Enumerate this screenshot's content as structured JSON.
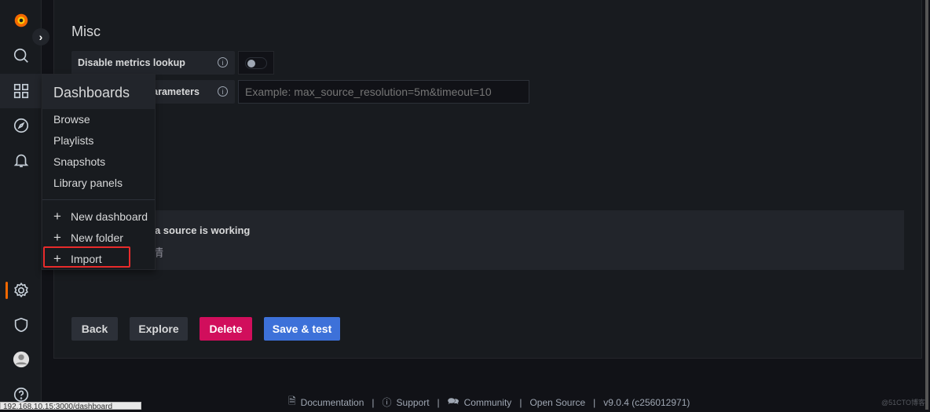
{
  "sidebar": {
    "items": [
      "grafana-logo",
      "search",
      "dashboards",
      "explore",
      "alerting",
      "configuration",
      "server-admin",
      "profile",
      "help"
    ]
  },
  "misc": {
    "title": "Misc",
    "disable_metrics_label": "Disable metrics lookup",
    "disable_metrics_enabled": false,
    "custom_params_label": "Custom query parameters",
    "custom_params_placeholder": "Example: max_source_resolution=5m&timeout=10"
  },
  "health": {
    "title": "Data source is working",
    "subtitle": "详情"
  },
  "buttons": {
    "back": "Back",
    "explore": "Explore",
    "delete": "Delete",
    "save": "Save & test"
  },
  "menu": {
    "title": "Dashboards",
    "items": [
      "Browse",
      "Playlists",
      "Snapshots",
      "Library panels"
    ],
    "actions": [
      "New dashboard",
      "New folder",
      "Import"
    ]
  },
  "footer": {
    "documentation": "Documentation",
    "support": "Support",
    "community": "Community",
    "open_source": "Open Source",
    "version": "v9.0.4 (c256012971)"
  },
  "status_url": "192.168.10.15:3000/dashboard",
  "watermark": "@51CTO博客",
  "colors": {
    "accent": "#f46800",
    "delete": "#d10e5c",
    "save": "#3d71d9",
    "highlight": "#e82b2b"
  }
}
